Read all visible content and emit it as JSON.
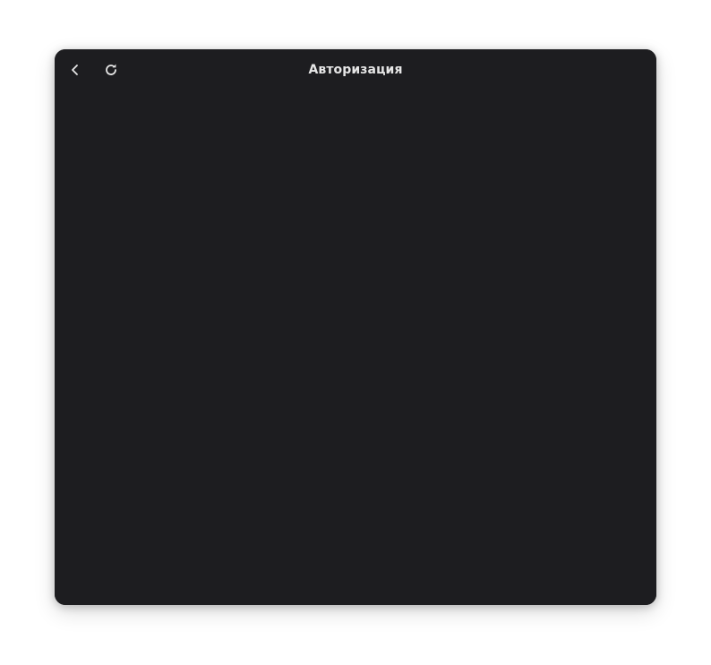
{
  "window": {
    "title": "Авторизация",
    "background": "#1d1d20",
    "title_color": "#e6e6e6"
  },
  "toolbar": {
    "back_icon": "chevron-left-icon",
    "reload_icon": "reload-icon"
  }
}
